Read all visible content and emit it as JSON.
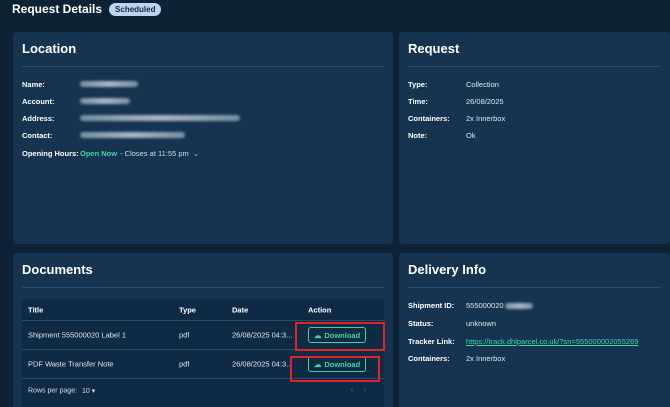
{
  "header": {
    "title": "Request Details",
    "status_badge": "Scheduled"
  },
  "location": {
    "title": "Location",
    "fields": [
      {
        "label": "Name:",
        "value": "ARGYLE STREET"
      },
      {
        "label": "Account:",
        "value": "WH Smith PLC"
      },
      {
        "label": "Address:",
        "value": "53-35 ARGYLE STREET, G2 8AH, GLASGOW, UK"
      },
      {
        "label": "Contact:",
        "value": "WH Smith PLC ARGYLE STREET"
      }
    ],
    "opening_hours_label": "Opening Hours:",
    "open_status": "Open Now",
    "closes_text": "- Closes at 11:55 pm"
  },
  "request": {
    "title": "Request",
    "fields": [
      {
        "label": "Type:",
        "value": "Collection"
      },
      {
        "label": "Time:",
        "value": "26/08/2025"
      },
      {
        "label": "Containers:",
        "value": "2x Innerbox"
      },
      {
        "label": "Note:",
        "value": "Ok"
      }
    ]
  },
  "documents": {
    "title": "Documents",
    "columns": [
      "Title",
      "Type",
      "Date",
      "Action"
    ],
    "rows": [
      {
        "title": "Shipment 555000020 Label 1",
        "type": "pdf",
        "date": "26/08/2025 04:3...",
        "action": "Download"
      },
      {
        "title": "PDF Waste Transfer Note",
        "type": "pdf",
        "date": "26/08/2025 04:3...",
        "action": "Download"
      }
    ],
    "rows_per_page_label": "Rows per page:",
    "rows_per_page_value": "10"
  },
  "delivery": {
    "title": "Delivery Info",
    "shipment_id_label": "Shipment ID:",
    "shipment_id_value": "555000020",
    "status_label": "Status:",
    "status_value": "unknown",
    "tracker_label": "Tracker Link:",
    "tracker_value": "https://track.dhlparcel.co.uk/?sn=555000002055269",
    "containers_label": "Containers:",
    "containers_value": "2x Innerbox"
  },
  "colors": {
    "accent": "#3dd6a4",
    "card_bg": "#163450",
    "page_bg": "#0e2236",
    "highlight": "#e02424"
  }
}
